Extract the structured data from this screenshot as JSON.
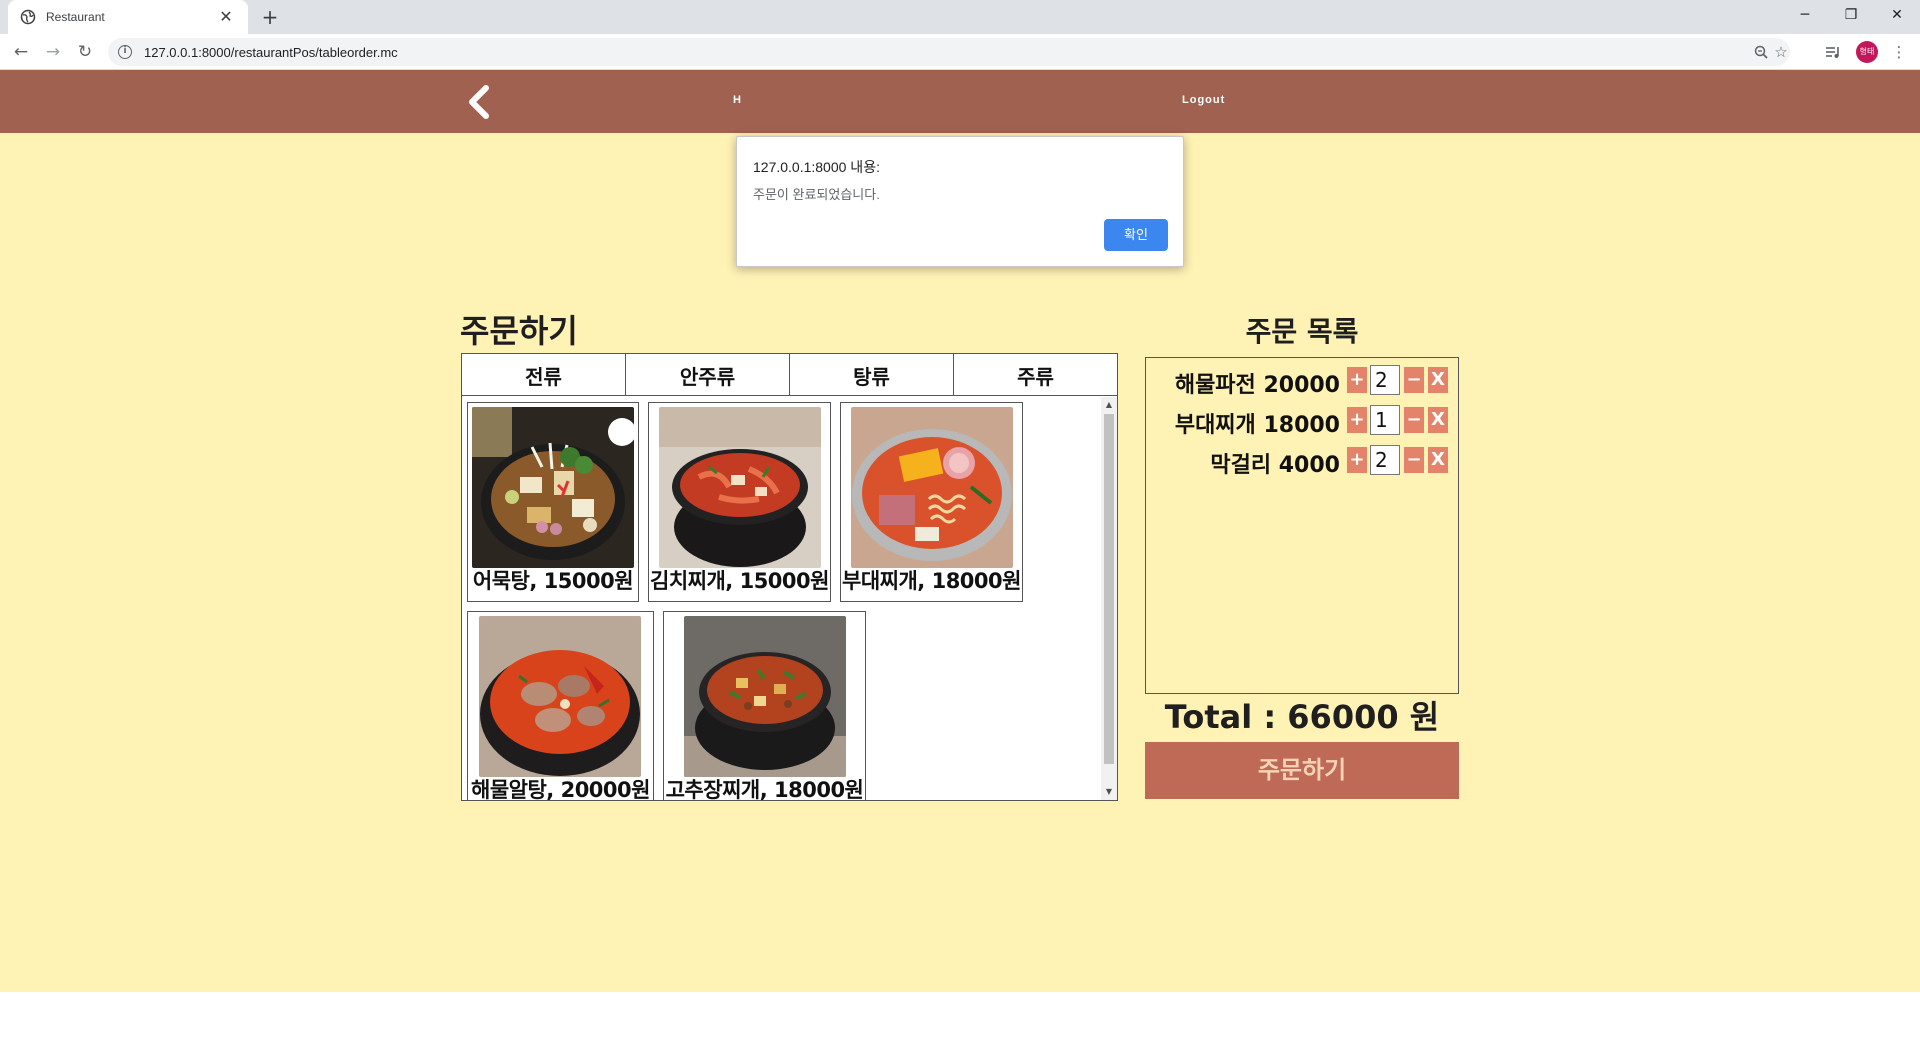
{
  "browser": {
    "tab_title": "Restaurant",
    "close_glyph": "✕",
    "new_tab_glyph": "+",
    "url": "127.0.0.1:8000/restaurantPos/tableorder.mc",
    "avatar_text": "형태",
    "window_controls": {
      "minimize": "─",
      "restore": "❐",
      "close": "✕"
    },
    "nav": {
      "back": "←",
      "forward": "→",
      "reload": "↻"
    }
  },
  "header": {
    "partial_text": "H",
    "logout": "Logout",
    "color": "#a06150"
  },
  "order_page": {
    "title": "주문하기",
    "categories": [
      "전류",
      "안주류",
      "탕류",
      "주류"
    ],
    "menu_items": [
      {
        "label": "어묵탕, 15000원",
        "image": "fish-cake-stew"
      },
      {
        "label": "김치찌개, 15000원",
        "image": "kimchi-stew"
      },
      {
        "label": "부대찌개, 18000원",
        "image": "army-stew"
      },
      {
        "label": "해물알탕, 20000원",
        "image": "seafood-roe-stew"
      },
      {
        "label": "고추장찌개, 18000원",
        "image": "gochujang-stew"
      }
    ]
  },
  "order_list": {
    "title": "주문 목록",
    "items": [
      {
        "label": "해물파전 20000",
        "qty": "2"
      },
      {
        "label": "부대찌개 18000",
        "qty": "1"
      },
      {
        "label": "막걸리 4000",
        "qty": "2"
      }
    ],
    "plus": "+",
    "minus": "−",
    "remove": "X",
    "total": "Total : 66000 원",
    "submit": "주문하기"
  },
  "alert": {
    "title": "127.0.0.1:8000 내용:",
    "message": "주문이 완료되었습니다.",
    "ok": "확인"
  },
  "colors": {
    "page_bg": "#fff2b5",
    "accent_button": "#bf6a57",
    "qty_button": "#e3836a",
    "dialog_button": "#3c86f0"
  }
}
